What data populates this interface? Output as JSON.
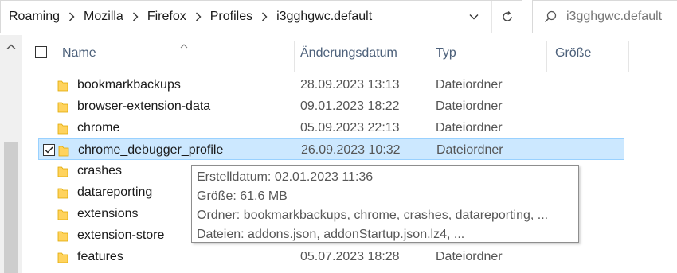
{
  "breadcrumb": [
    "Roaming",
    "Mozilla",
    "Firefox",
    "Profiles",
    "i3gghgwc.default"
  ],
  "search": {
    "placeholder": "i3gghgwc.default"
  },
  "columns": {
    "name": "Name",
    "date": "Änderungsdatum",
    "type": "Typ",
    "size": "Größe"
  },
  "rows": [
    {
      "name": "bookmarkbackups",
      "date": "28.09.2023 13:13",
      "type": "Dateiordner"
    },
    {
      "name": "browser-extension-data",
      "date": "09.01.2023 18:22",
      "type": "Dateiordner"
    },
    {
      "name": "chrome",
      "date": "05.09.2023 22:13",
      "type": "Dateiordner"
    },
    {
      "name": "chrome_debugger_profile",
      "date": "26.09.2023 10:32",
      "type": "Dateiordner",
      "selected": true
    },
    {
      "name": "crashes",
      "date": "",
      "type": ""
    },
    {
      "name": "datareporting",
      "date": "",
      "type": ""
    },
    {
      "name": "extensions",
      "date": "",
      "type": ""
    },
    {
      "name": "extension-store",
      "date": "",
      "type": ""
    },
    {
      "name": "features",
      "date": "05.07.2023 18:28",
      "type": "Dateiordner"
    }
  ],
  "tooltip": {
    "line1": "Erstelldatum: 02.01.2023 11:36",
    "line2": "Größe: 61,6 MB",
    "line3": "Ordner: bookmarkbackups, chrome, crashes, datareporting, ...",
    "line4": "Dateien: addons.json, addonStartup.json.lz4, ..."
  },
  "icons": {
    "folder": "folder-icon",
    "search": "search-icon",
    "refresh": "refresh-icon",
    "dropdown": "chevron-down-icon",
    "scroll_up": "scroll-up-arrow-icon",
    "sort": "sort-ascending-icon"
  },
  "colors": {
    "folder": "#ffd35e",
    "selection": "#cce8ff",
    "header_text": "#4c607a"
  }
}
